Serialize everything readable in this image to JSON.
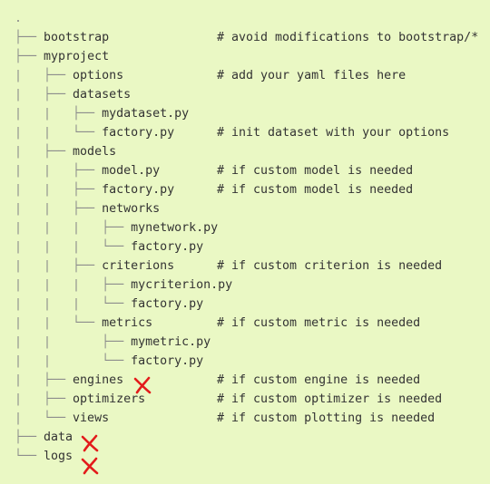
{
  "tree": [
    {
      "prefix": ".",
      "name": "",
      "comment": ""
    },
    {
      "prefix": "├── ",
      "name": "bootstrap",
      "comment": "# avoid modifications to bootstrap/*"
    },
    {
      "prefix": "├── ",
      "name": "myproject",
      "comment": ""
    },
    {
      "prefix": "|   ├── ",
      "name": "options",
      "comment": "# add your yaml files here"
    },
    {
      "prefix": "|   ├── ",
      "name": "datasets",
      "comment": ""
    },
    {
      "prefix": "|   |   ├── ",
      "name": "mydataset.py",
      "comment": ""
    },
    {
      "prefix": "|   |   └── ",
      "name": "factory.py",
      "comment": "# init dataset with your options"
    },
    {
      "prefix": "|   ├── ",
      "name": "models",
      "comment": ""
    },
    {
      "prefix": "|   |   ├── ",
      "name": "model.py",
      "comment": "# if custom model is needed"
    },
    {
      "prefix": "|   |   ├── ",
      "name": "factory.py",
      "comment": "# if custom model is needed"
    },
    {
      "prefix": "|   |   ├── ",
      "name": "networks",
      "comment": ""
    },
    {
      "prefix": "|   |   |   ├── ",
      "name": "mynetwork.py",
      "comment": ""
    },
    {
      "prefix": "|   |   |   └── ",
      "name": "factory.py",
      "comment": ""
    },
    {
      "prefix": "|   |   ├── ",
      "name": "criterions",
      "comment": "# if custom criterion is needed"
    },
    {
      "prefix": "|   |   |   ├── ",
      "name": "mycriterion.py",
      "comment": ""
    },
    {
      "prefix": "|   |   |   └── ",
      "name": "factory.py",
      "comment": ""
    },
    {
      "prefix": "|   |   └── ",
      "name": "metrics",
      "comment": "# if custom metric is needed"
    },
    {
      "prefix": "|   |       ├── ",
      "name": "mymetric.py",
      "comment": ""
    },
    {
      "prefix": "|   |       └── ",
      "name": "factory.py",
      "comment": ""
    },
    {
      "prefix": "|   ├── ",
      "name": "engines",
      "comment": "# if custom engine is needed"
    },
    {
      "prefix": "|   ├── ",
      "name": "optimizers",
      "comment": "# if custom optimizer is needed"
    },
    {
      "prefix": "|   └── ",
      "name": "views",
      "comment": "# if custom plotting is needed"
    },
    {
      "prefix": "├── ",
      "name": "data",
      "comment": ""
    },
    {
      "prefix": "└── ",
      "name": "logs",
      "comment": ""
    }
  ],
  "marks": {
    "icon": "red-cross-mark-icon",
    "color": "#e31b1b"
  },
  "colors": {
    "background": "#eaf8c4",
    "text": "#333333",
    "guides": "#8c8c8c"
  }
}
